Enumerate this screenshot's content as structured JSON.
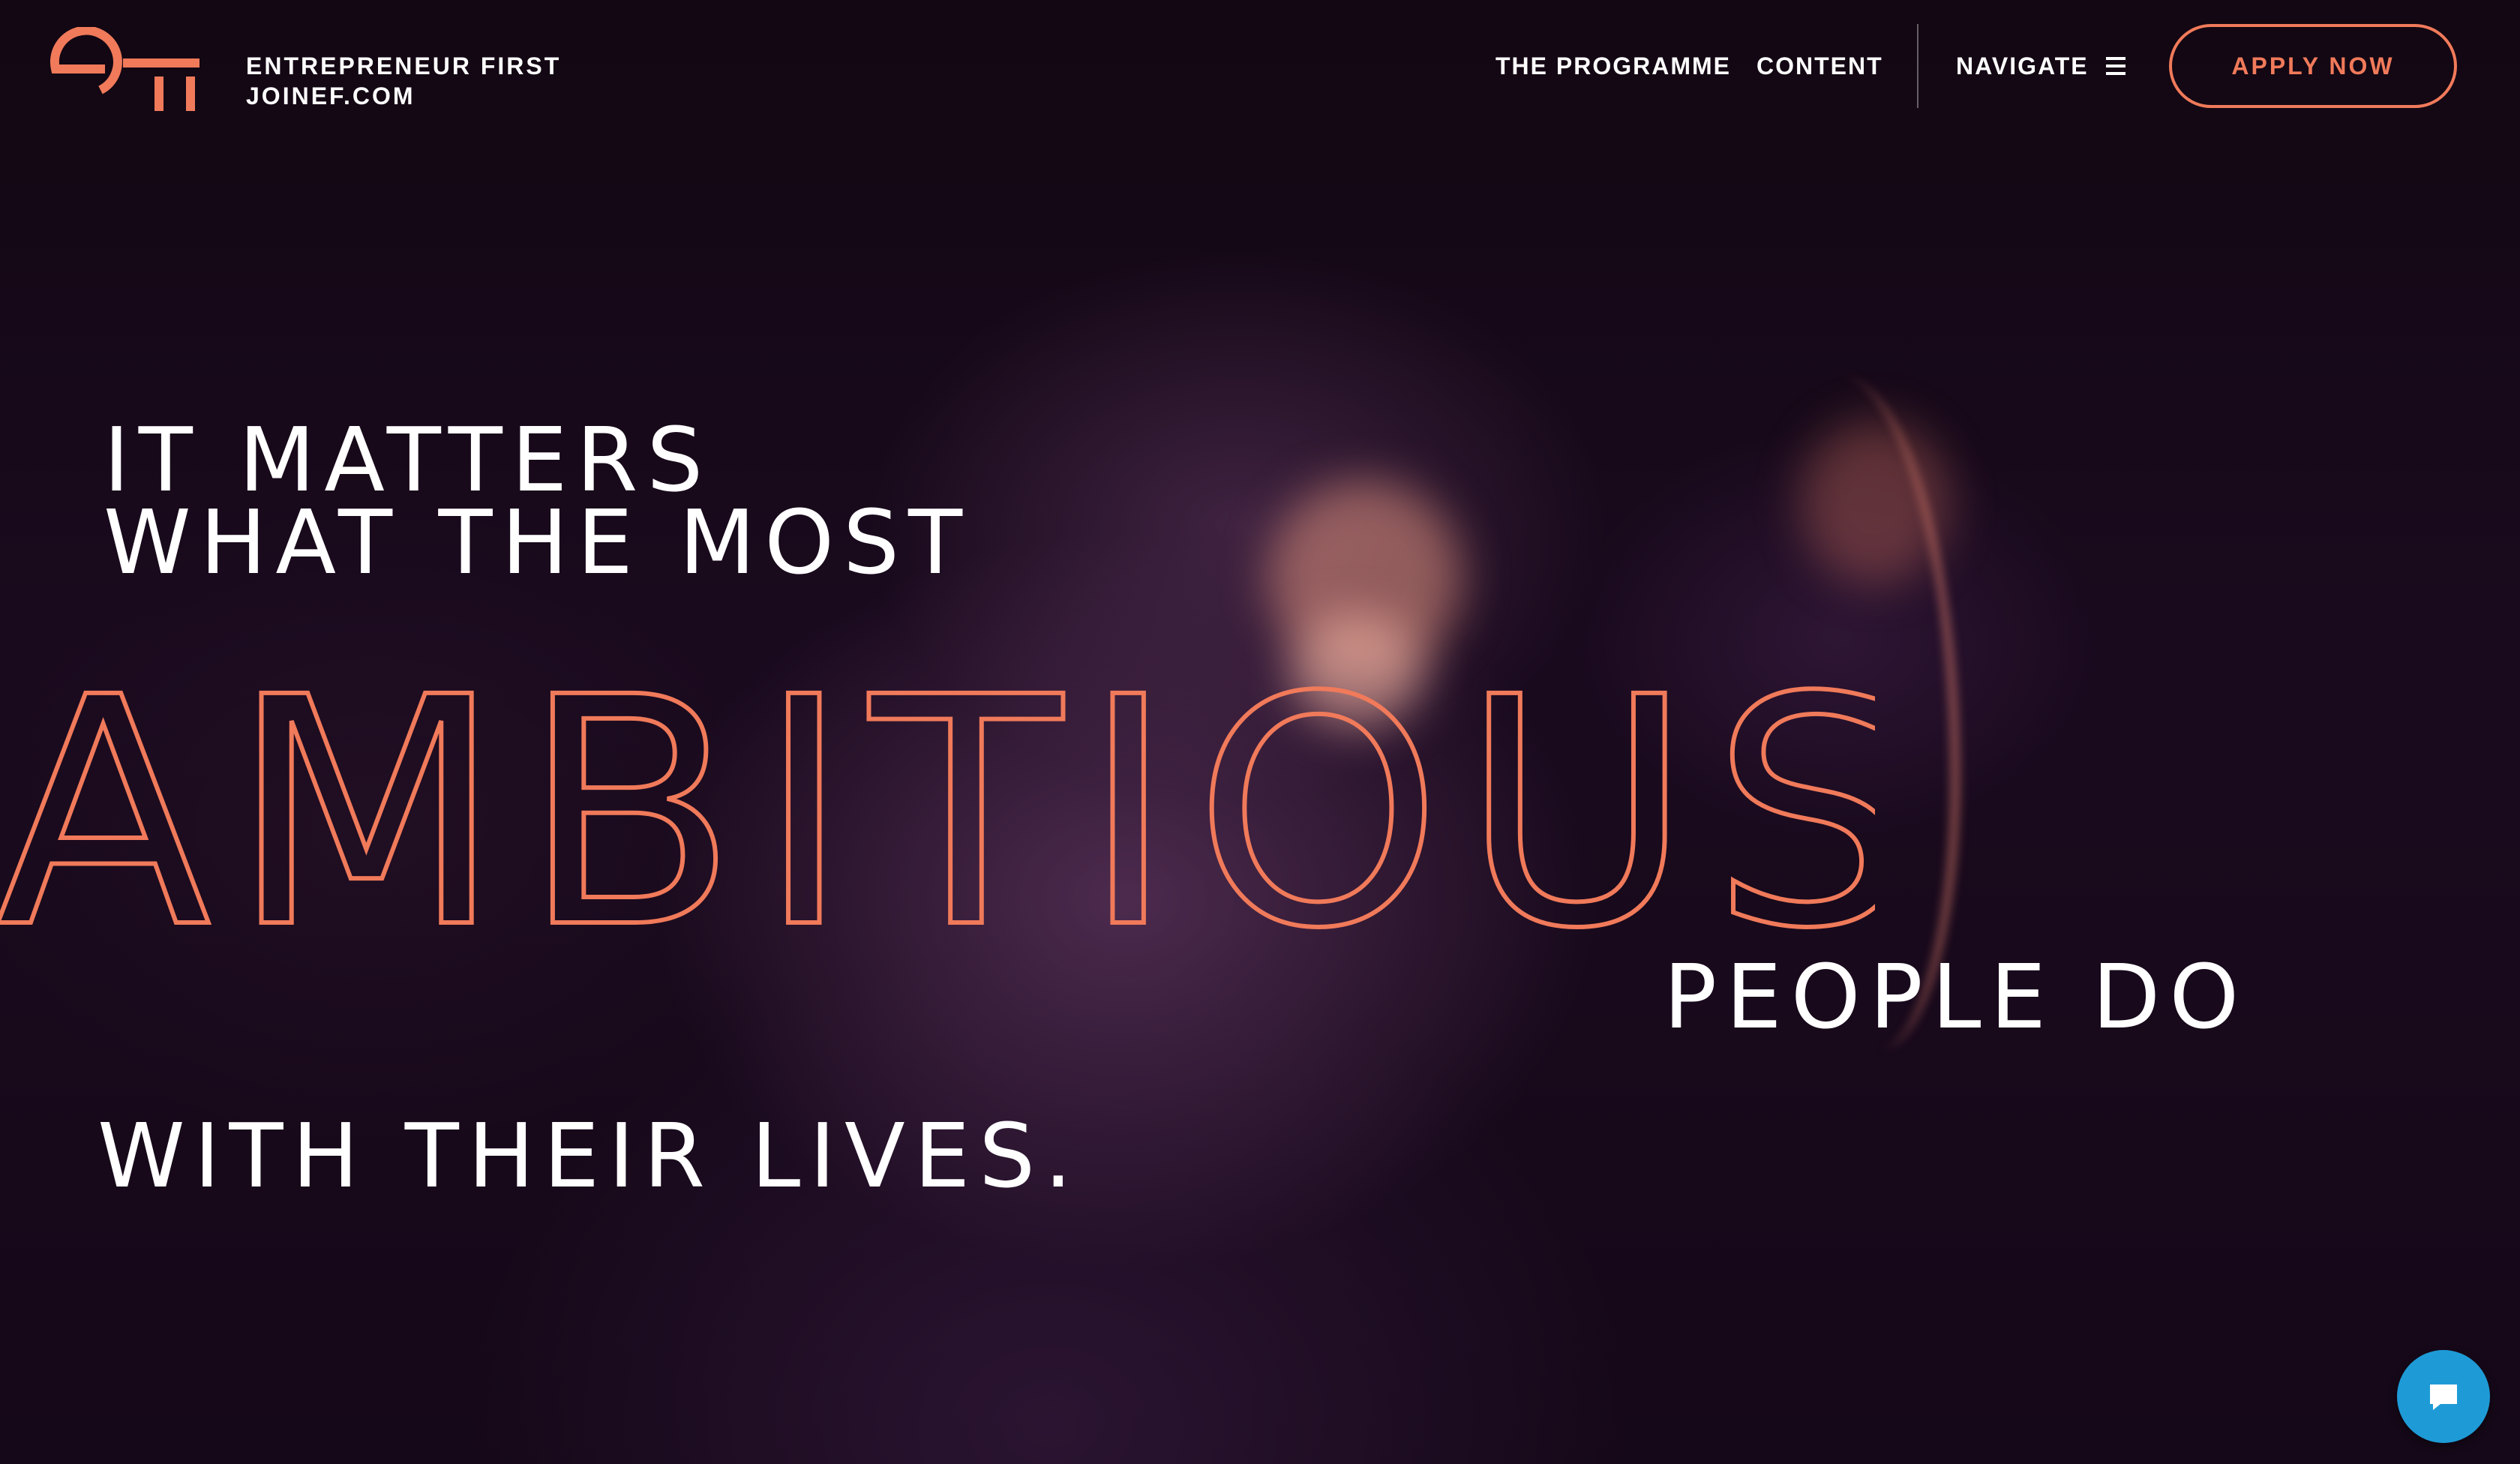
{
  "header": {
    "brand_line1": "ENTREPRENEUR FIRST",
    "brand_line2": "JOINEF.COM",
    "nav": [
      {
        "label": "THE PROGRAMME"
      },
      {
        "label": "CONTENT"
      },
      {
        "label": "NAVIGATE"
      }
    ],
    "apply_label": "APPLY NOW",
    "logo_icon": "ef-logo",
    "menu_icon": "hamburger-icon"
  },
  "hero": {
    "line1": "IT MATTERS",
    "line2": "WHAT THE MOST",
    "highlight": "AMBITIOUS",
    "line3": "PEOPLE DO",
    "line4": "WITH THEIR LIVES."
  },
  "chat": {
    "icon": "chat-bubble-icon"
  },
  "colors": {
    "accent": "#f07a5a",
    "background": "#150818",
    "chat": "#1e9bd7",
    "text": "#ffffff"
  }
}
